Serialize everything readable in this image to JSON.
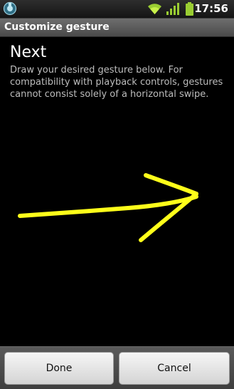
{
  "status_bar": {
    "time": "17:56",
    "icons": [
      "notification-icon",
      "wifi-icon",
      "signal-icon",
      "battery-icon"
    ],
    "accent_color": "#9acd32"
  },
  "title_bar": {
    "title": "Customize gesture"
  },
  "content": {
    "heading": "Next",
    "instructions": "Draw your desired gesture below. For compatibility with playback controls, gestures cannot consist solely of a horizontal swipe."
  },
  "gesture": {
    "description_icon": "right-arrow-stroke",
    "stroke_color": "#ffff1a"
  },
  "buttons": {
    "done_label": "Done",
    "cancel_label": "Cancel"
  }
}
